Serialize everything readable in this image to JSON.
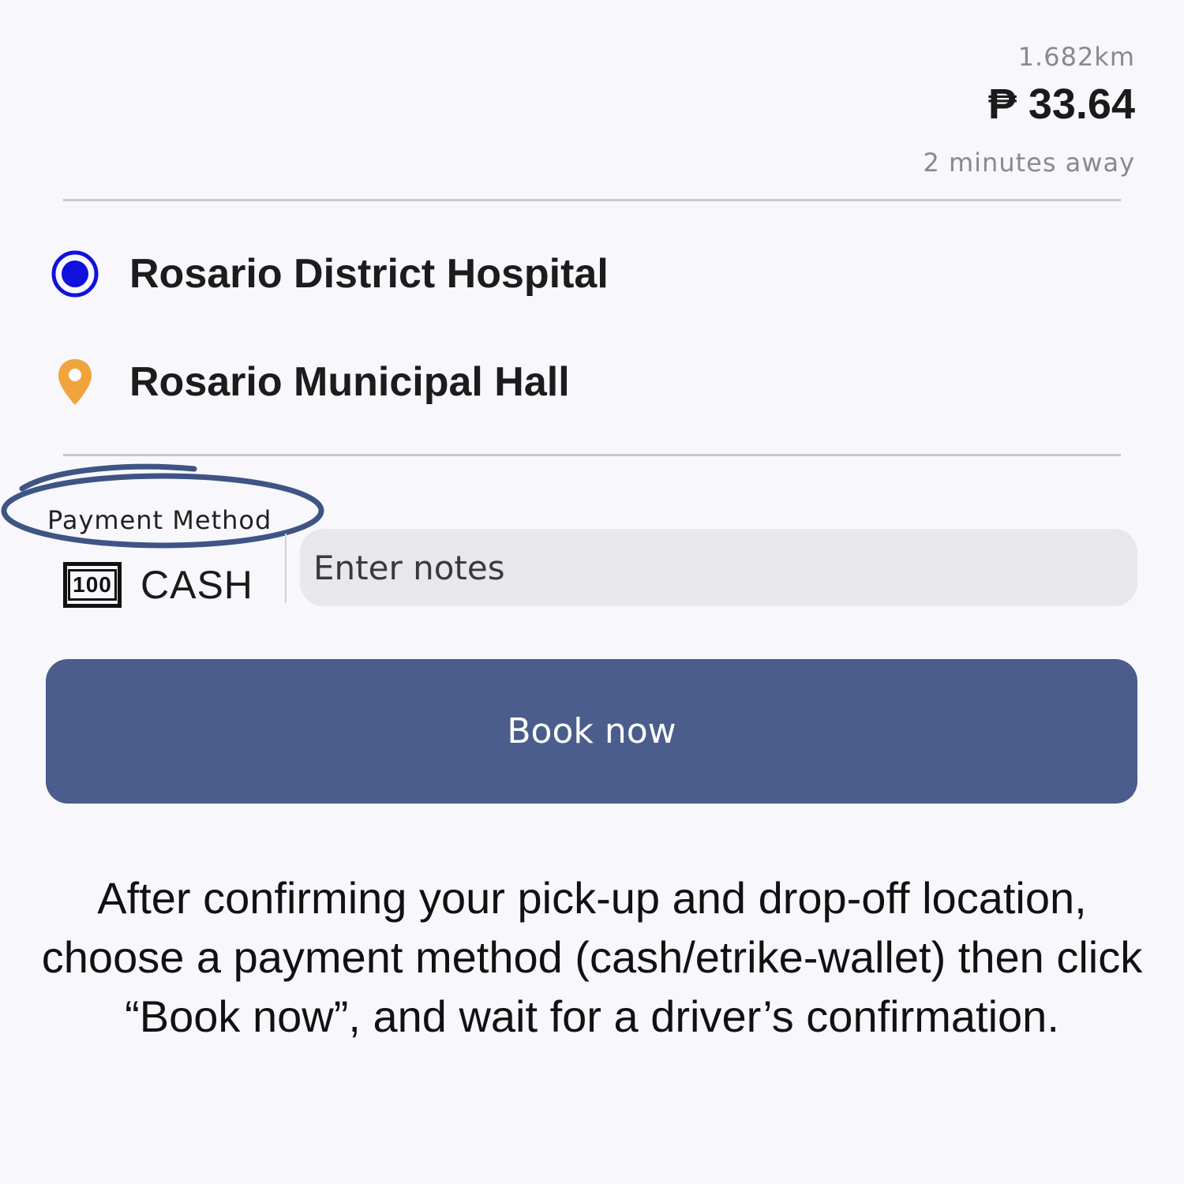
{
  "trip": {
    "distance": "1.682km",
    "fare": "₱ 33.64",
    "eta": "2 minutes away"
  },
  "locations": {
    "pickup": {
      "label": "Rosario District Hospital",
      "icon": "radio-dot-icon",
      "color": "#1111dd"
    },
    "dropoff": {
      "label": "Rosario Municipal Hall",
      "icon": "map-pin-icon",
      "color": "#f0a43b"
    }
  },
  "payment": {
    "title": "Payment Method",
    "icon_text": "100",
    "icon": "cash-banknote-icon",
    "method": "CASH",
    "highlight_color": "#3f5485"
  },
  "notes": {
    "placeholder": "Enter notes",
    "value": ""
  },
  "actions": {
    "book_label": "Book now",
    "book_color": "#4a5d8c"
  },
  "instructions": {
    "text": "After confirming your pick-up and drop-off location, choose a payment method (cash/etrike-wallet) then click “Book now”, and wait for a driver’s confirmation."
  }
}
